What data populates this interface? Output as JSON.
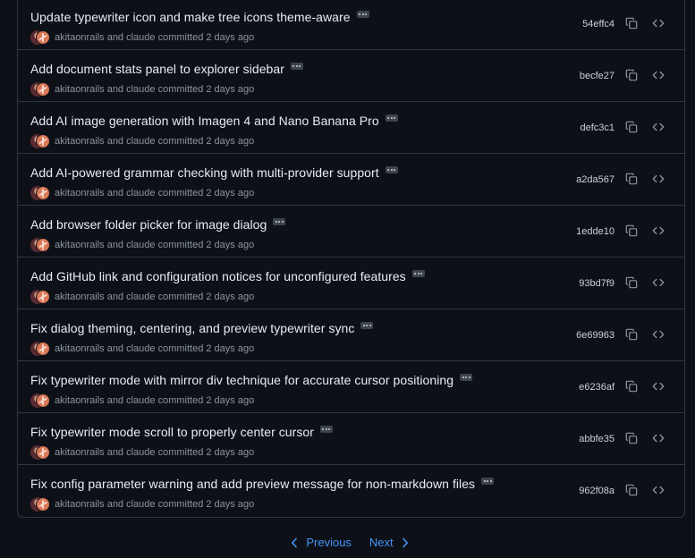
{
  "commits": [
    {
      "title": "Update typewriter icon and make tree icons theme-aware",
      "sha": "54effc4"
    },
    {
      "title": "Add document stats panel to explorer sidebar",
      "sha": "becfe27"
    },
    {
      "title": "Add AI image generation with Imagen 4 and Nano Banana Pro",
      "sha": "defc3c1"
    },
    {
      "title": "Add AI-powered grammar checking with multi-provider support",
      "sha": "a2da567"
    },
    {
      "title": "Add browser folder picker for image dialog",
      "sha": "1edde10"
    },
    {
      "title": "Add GitHub link and configuration notices for unconfigured features",
      "sha": "93bd7f9"
    },
    {
      "title": "Fix dialog theming, centering, and preview typewriter sync",
      "sha": "6e69963"
    },
    {
      "title": "Fix typewriter mode with mirror div technique for accurate cursor positioning",
      "sha": "e6236af"
    },
    {
      "title": "Fix typewriter mode scroll to properly center cursor",
      "sha": "abbfe35"
    },
    {
      "title": "Fix config parameter warning and add preview message for non-markdown files",
      "sha": "962f08a"
    }
  ],
  "commit_meta": "akitaonrails and claude committed 2 days ago",
  "pagination": {
    "previous_label": "Previous",
    "next_label": "Next"
  },
  "icons": {
    "copy": "copy-icon",
    "browse": "code-icon",
    "more": "ellipsis-icon",
    "prev": "chevron-left-icon",
    "next": "chevron-right-icon"
  },
  "colors": {
    "background": "#0d1117",
    "border": "#30363d",
    "text": "#e6edf3",
    "muted": "#8b949e",
    "link": "#4493f8"
  }
}
